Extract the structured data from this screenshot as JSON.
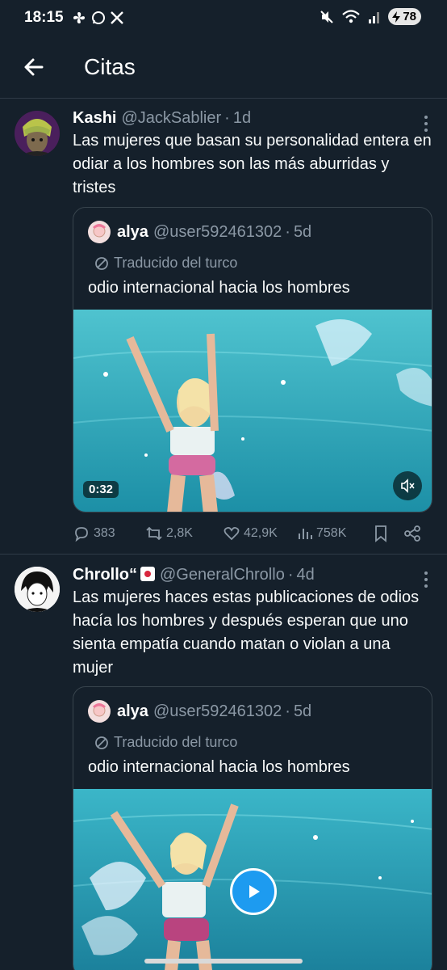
{
  "status_bar": {
    "time": "18:15",
    "battery": "78"
  },
  "header": {
    "title": "Citas"
  },
  "tweets": [
    {
      "name": "Kashi",
      "handle": "@JackSablier",
      "time": "1d",
      "text": "Las mujeres que basan su personalidad entera en odiar a los hombres son las más aburridas y tristes",
      "quote": {
        "name": "alya",
        "handle": "@user592461302",
        "time": "5d",
        "translated": "Traducido del turco",
        "text": "odio internacional hacia los hombres",
        "video_duration": "0:32"
      },
      "actions": {
        "replies": "383",
        "reposts": "2,8K",
        "likes": "42,9K",
        "views": "758K"
      }
    },
    {
      "name": "Chrollo“",
      "handle": "@GeneralChrollo",
      "time": "4d",
      "text": "Las mujeres haces estas publicaciones de odios hacía los hombres y después esperan que uno sienta empatía cuando matan o violan a una mujer",
      "quote": {
        "name": "alya",
        "handle": "@user592461302",
        "time": "5d",
        "translated": "Traducido del turco",
        "text": "odio internacional hacia los hombres"
      }
    }
  ],
  "colors": {
    "background": "#15202b",
    "secondary_text": "#8b98a5",
    "border": "#2f3b47",
    "accent": "#1d9bf0"
  }
}
